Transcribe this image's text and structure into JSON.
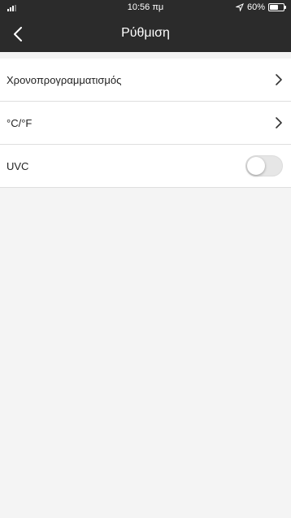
{
  "status_bar": {
    "time": "10:56 πμ",
    "battery_text": "60%",
    "battery_level": 0.6
  },
  "nav": {
    "title": "Ρύθμιση",
    "back_icon": "chevron-left-icon"
  },
  "settings": {
    "items": [
      {
        "label": "Χρονοπρογραμματισμός",
        "type": "link"
      },
      {
        "label": "°C/°F",
        "type": "link"
      },
      {
        "label": "UVC",
        "type": "toggle",
        "value": false
      }
    ]
  },
  "colors": {
    "header_bg": "#2b2b2b",
    "page_bg": "#f4f4f4"
  }
}
